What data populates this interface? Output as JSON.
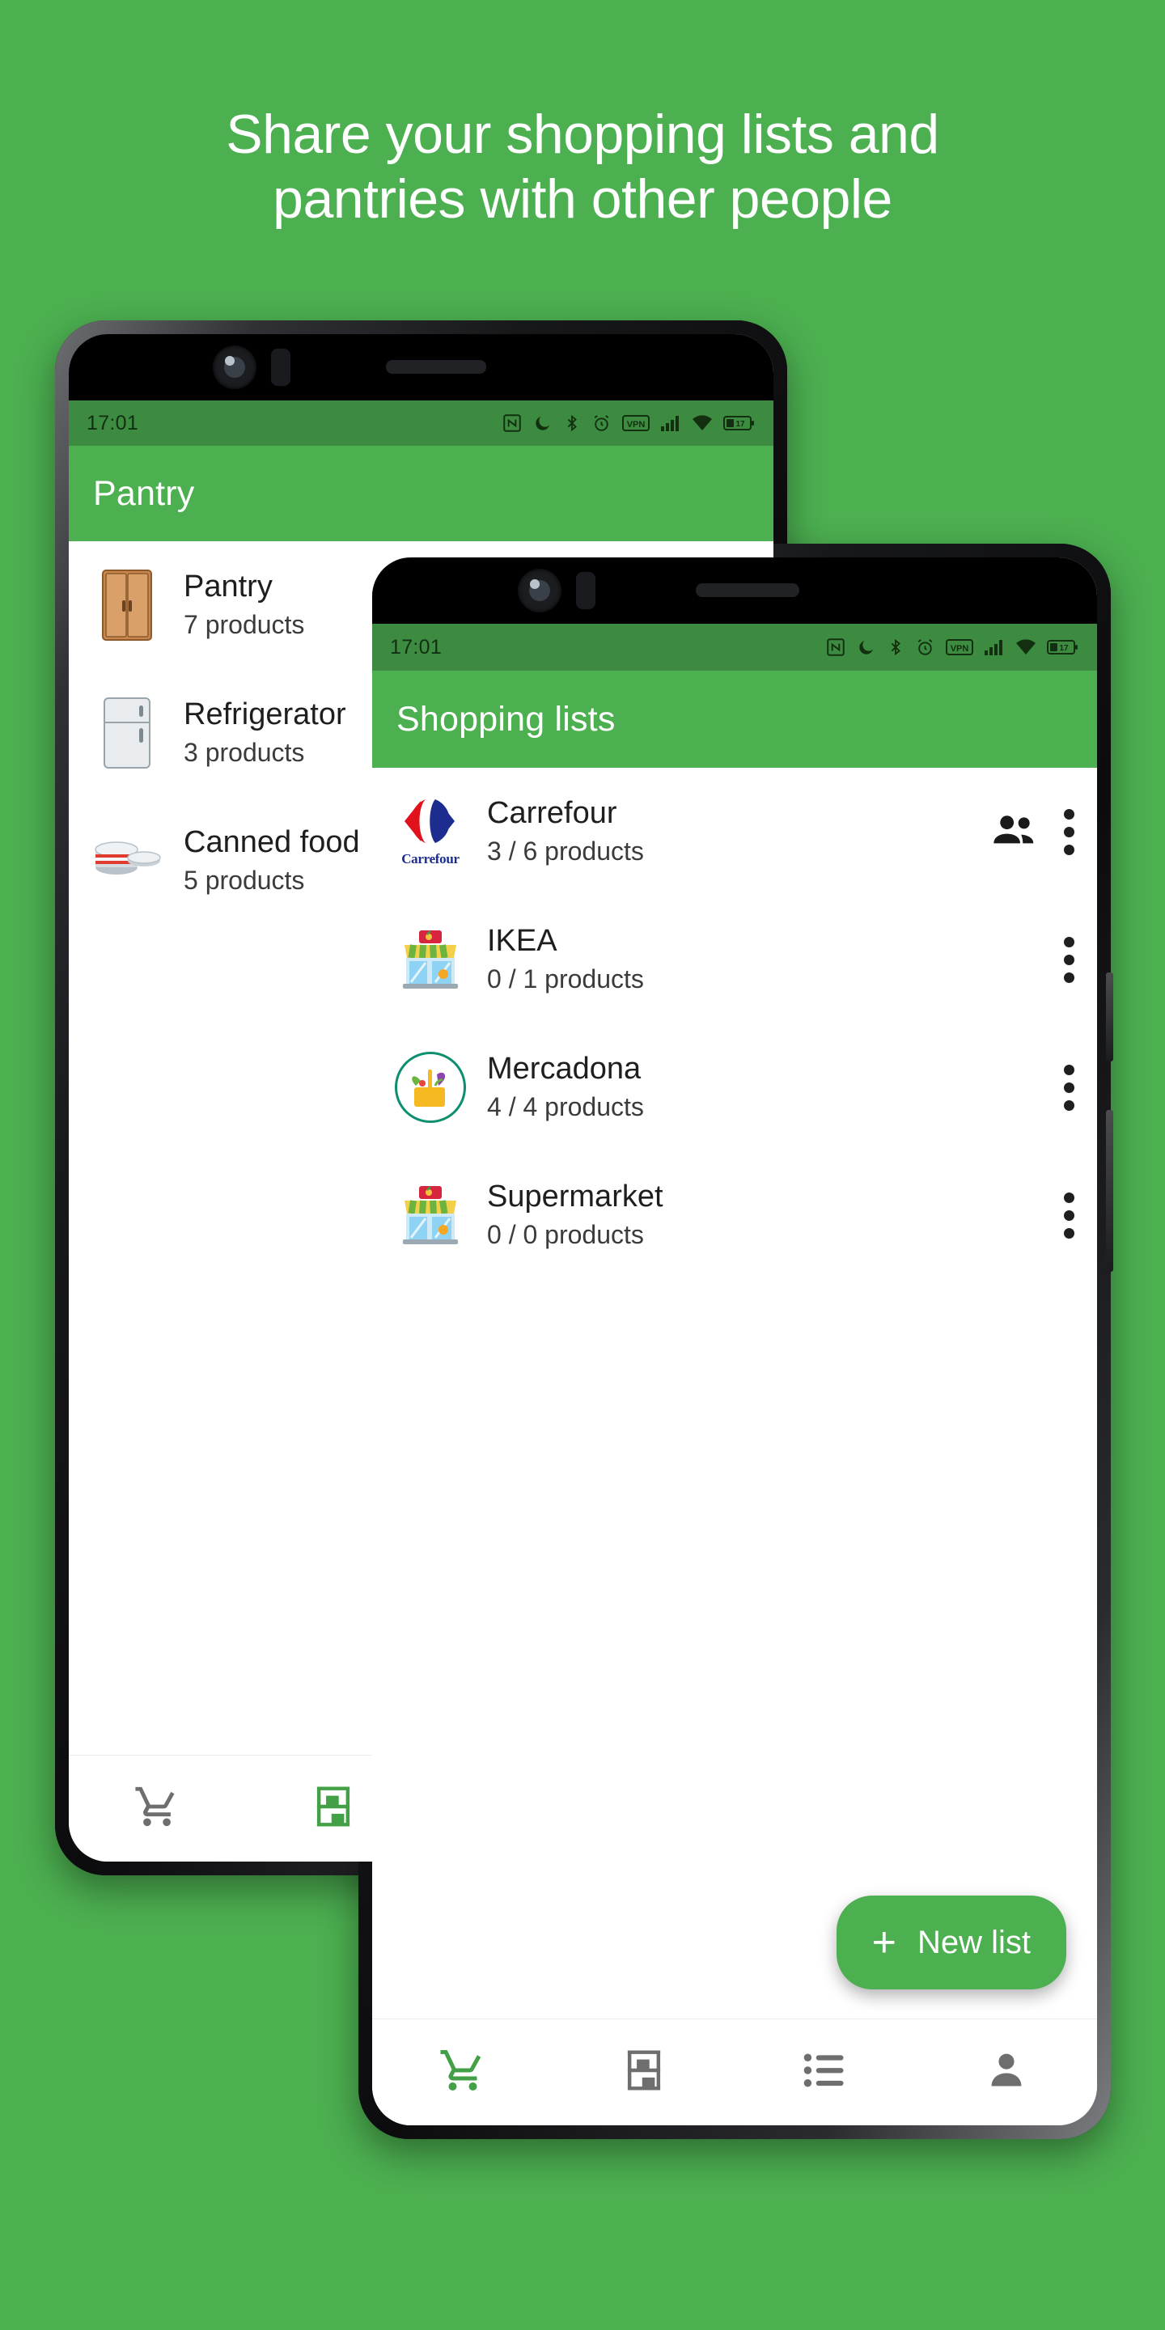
{
  "headline": {
    "line1": "Share your shopping lists and",
    "line2": "pantries with other people"
  },
  "colors": {
    "background": "#4caf50",
    "appbar": "#4caf50",
    "statusbar": "#3d8b40",
    "accent": "#4caf50",
    "fab": "#4caf50",
    "nav_active": "#43a047",
    "nav_inactive": "#6e6e6e"
  },
  "phone_back": {
    "status": {
      "time": "17:01",
      "icons": [
        "nfc-icon",
        "do-not-disturb-icon",
        "bluetooth-icon",
        "alarm-icon",
        "vpn-icon",
        "signal-icon",
        "wifi-icon",
        "battery-icon"
      ],
      "battery_level": "17"
    },
    "appbar": {
      "title": "Pantry"
    },
    "items": [
      {
        "icon": "wardrobe-emoji",
        "glyph": "🚪",
        "name": "Pantry",
        "sub": "7 products"
      },
      {
        "icon": "refrigerator-emoji",
        "glyph": "🧊",
        "name": "Refrigerator",
        "sub": "3 products"
      },
      {
        "icon": "canned-food-emoji",
        "glyph": "🥫",
        "name": "Canned food",
        "sub": "5 products"
      }
    ],
    "nav": [
      {
        "icon": "cart-icon",
        "active": false
      },
      {
        "icon": "pantry-shelves-icon",
        "active": true
      }
    ]
  },
  "phone_front": {
    "status": {
      "time": "17:01",
      "icons": [
        "nfc-icon",
        "do-not-disturb-icon",
        "bluetooth-icon",
        "alarm-icon",
        "vpn-icon",
        "signal-icon",
        "wifi-icon",
        "battery-icon"
      ],
      "battery_level": "17"
    },
    "appbar": {
      "title": "Shopping lists"
    },
    "items": [
      {
        "icon": "carrefour-logo",
        "brand_word": "Carrefour",
        "name": "Carrefour",
        "sub": "3 / 6 products",
        "shared": true,
        "menu": "overflow-menu-icon"
      },
      {
        "icon": "convenience-store-emoji",
        "glyph": "🏪",
        "name": "IKEA",
        "sub": "0 / 1 products",
        "shared": false,
        "menu": "overflow-menu-icon"
      },
      {
        "icon": "mercadona-logo",
        "name": "Mercadona",
        "sub": "4 / 4 products",
        "shared": false,
        "menu": "overflow-menu-icon"
      },
      {
        "icon": "convenience-store-emoji",
        "glyph": "🏪",
        "name": "Supermarket",
        "sub": "0 / 0 products",
        "shared": false,
        "menu": "overflow-menu-icon"
      }
    ],
    "fab": {
      "label": "New list",
      "plus": "+"
    },
    "nav": [
      {
        "icon": "cart-icon",
        "active": true
      },
      {
        "icon": "pantry-shelves-icon",
        "active": false
      },
      {
        "icon": "list-icon",
        "active": false
      },
      {
        "icon": "person-icon",
        "active": false
      }
    ]
  }
}
